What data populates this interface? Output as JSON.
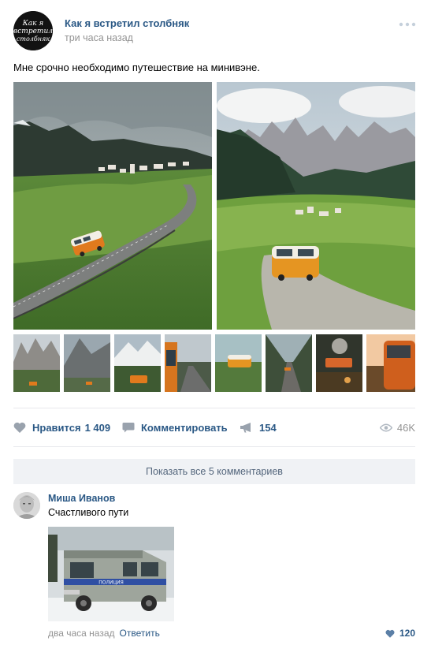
{
  "post": {
    "group_name": "Как я встретил столбняк",
    "time": "три часа назад",
    "text": "Мне срочно необходимо путешествие на минивэне.",
    "logo_text": [
      "Как я",
      "встретил",
      "столбняк"
    ]
  },
  "photos": {
    "main": [
      "road-valley-orange-van",
      "mountain-village-orange-van"
    ],
    "thumbs": [
      "dolomites-peaks",
      "rocky-mountain",
      "snowy-peaks-van",
      "van-mirror-road",
      "orange-van-field",
      "forest-road-van",
      "van-trees-sunset",
      "van-side-sunset"
    ]
  },
  "actions": {
    "like_label": "Нравится",
    "like_count": "1 409",
    "comment_label": "Комментировать",
    "share_count": "154",
    "views": "46K"
  },
  "comments": {
    "show_all": "Показать все 5 комментариев",
    "items": [
      {
        "author": "Миша Иванов",
        "text": "Счастливого пути",
        "time": "два часа назад",
        "reply_label": "Ответить",
        "likes": "120",
        "photo_badge": "ПОЛИЦИЯ"
      }
    ]
  },
  "colors": {
    "link": "#2a5885",
    "muted": "#939393",
    "divider": "#e7e8ec",
    "button_bg": "#f0f2f5",
    "icon": "#99a2ad"
  }
}
